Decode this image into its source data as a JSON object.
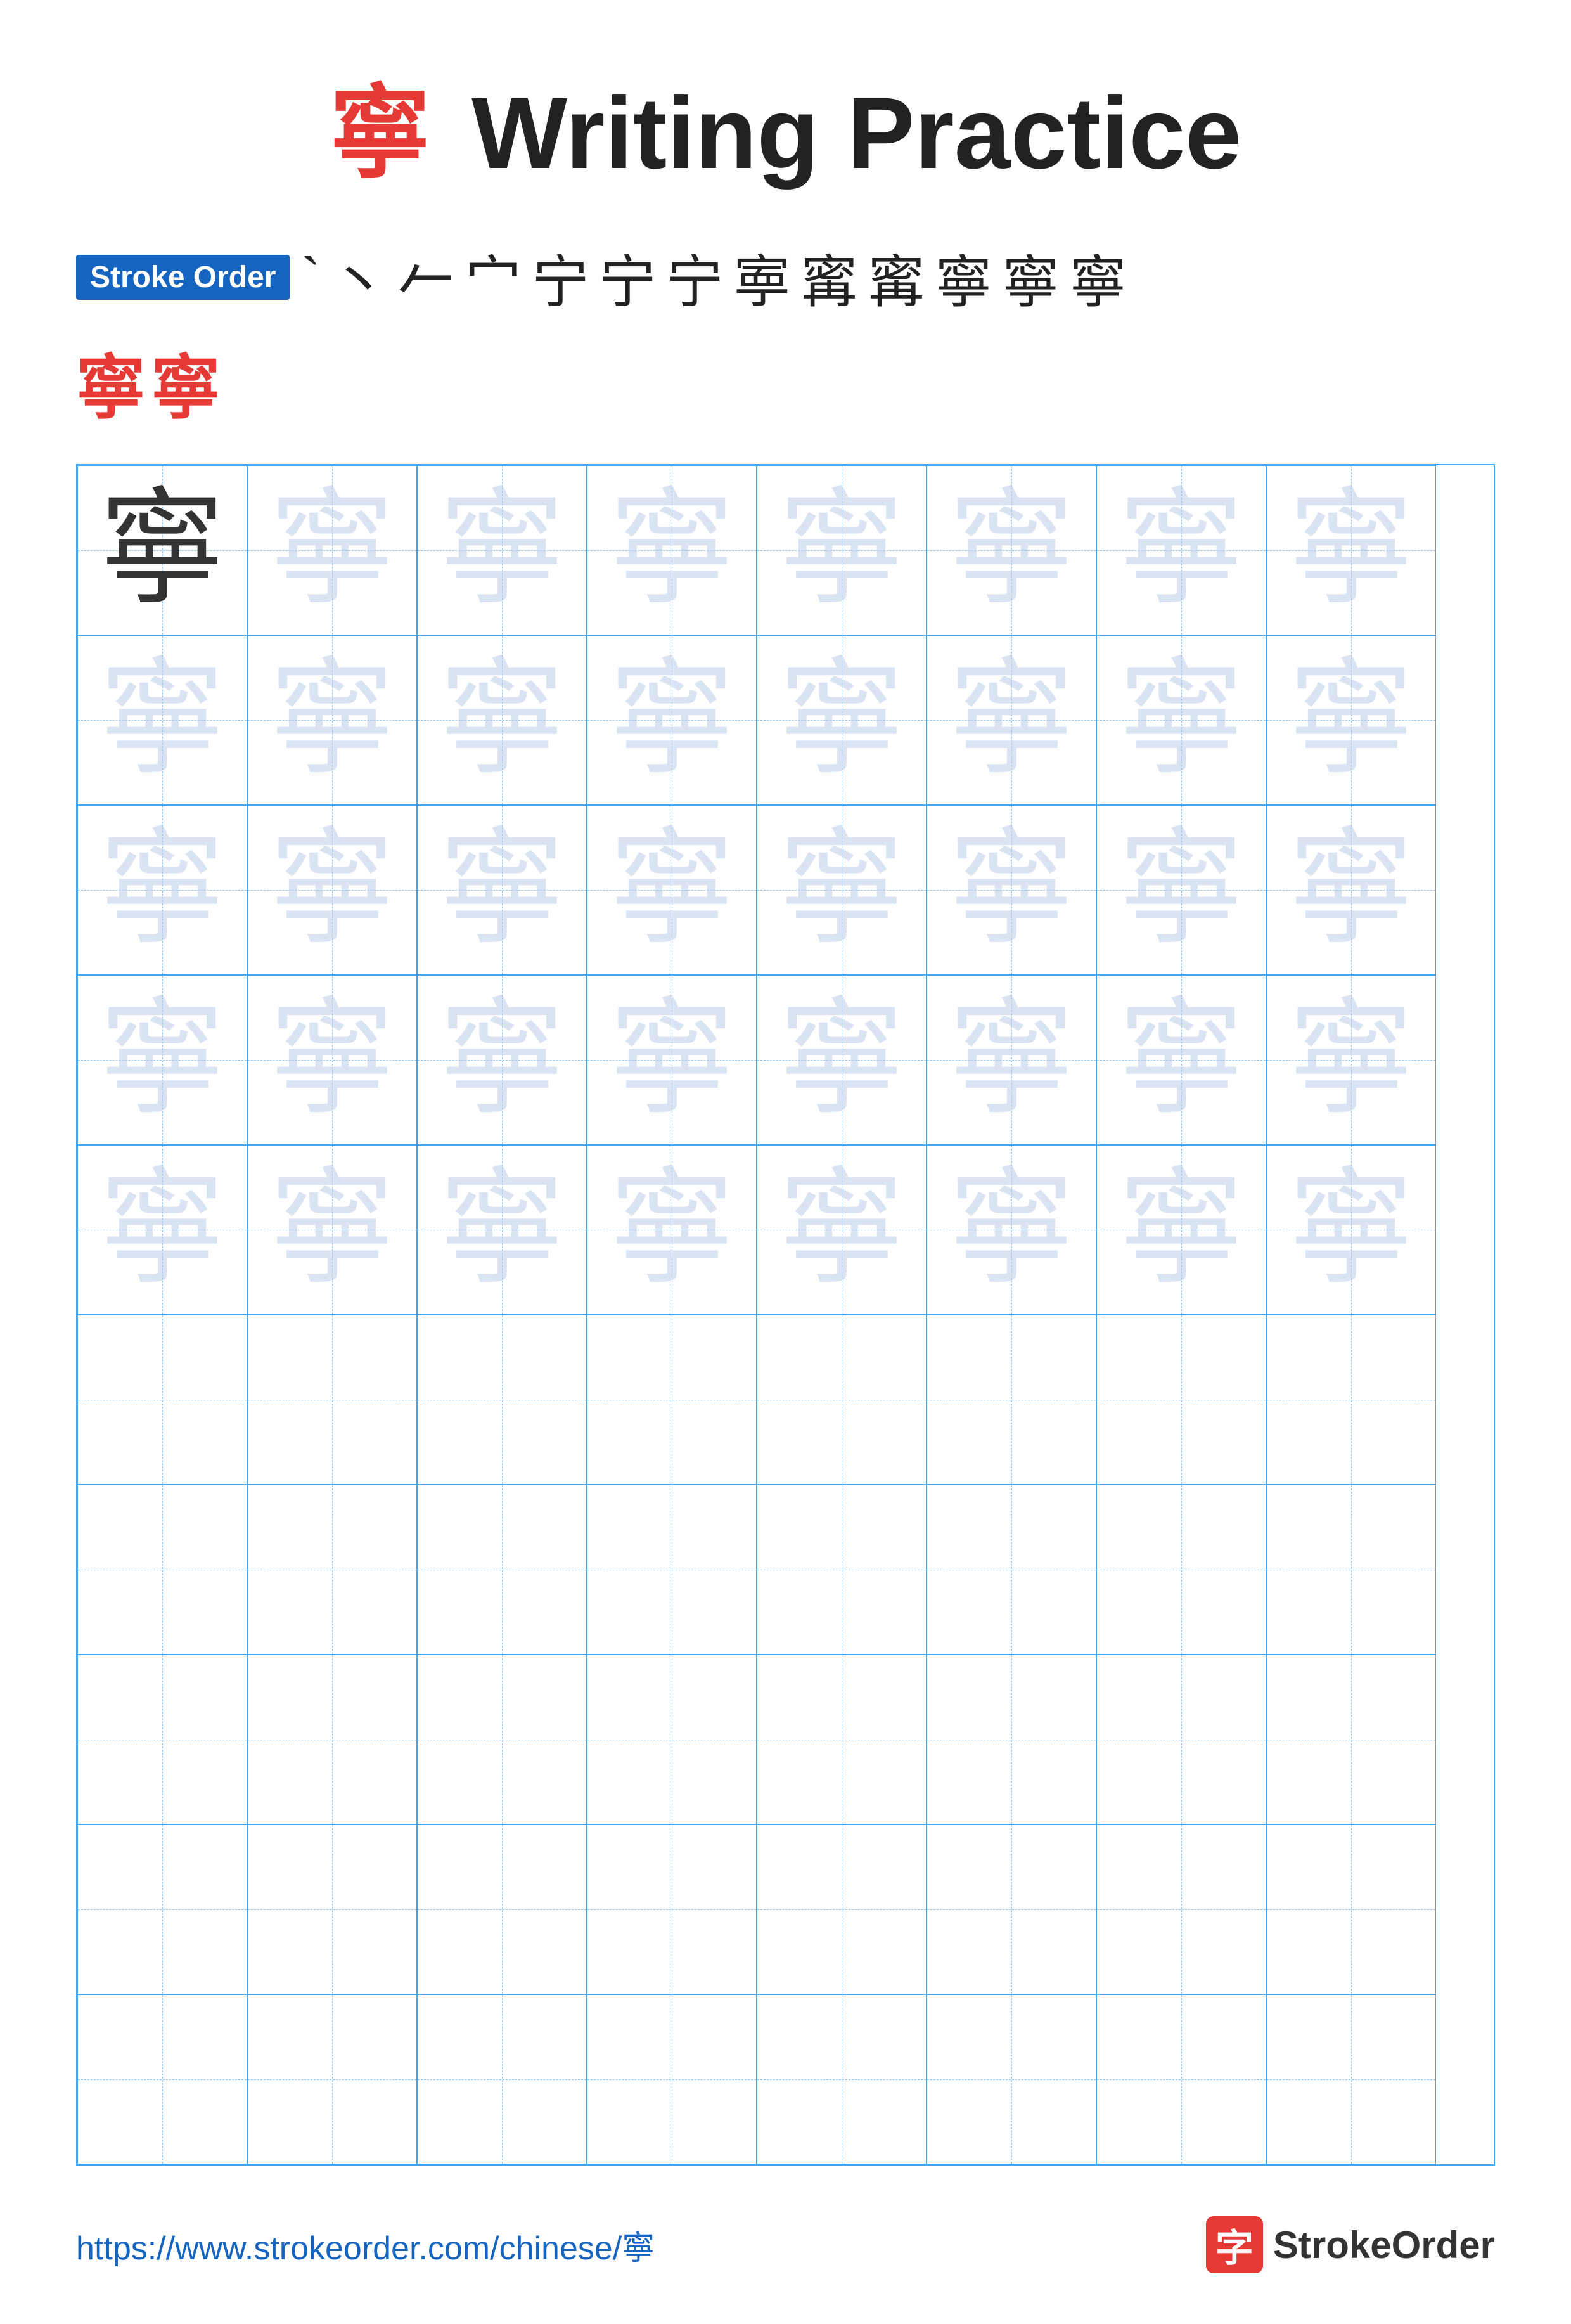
{
  "title": {
    "char": "寧",
    "rest": " Writing Practice"
  },
  "stroke_order": {
    "badge": "Stroke Order",
    "strokes": [
      "`",
      "丶",
      "𠂉",
      "宀",
      "宁",
      "宁",
      "宁",
      "寕",
      "寗",
      "寗",
      "寧",
      "寧",
      "寧"
    ],
    "row2": [
      "寧",
      "寧"
    ]
  },
  "practice_char": "寧",
  "grid": {
    "cols": 8,
    "rows": 10,
    "filled_rows": 5
  },
  "footer": {
    "url": "https://www.strokeorder.com/chinese/寧",
    "brand": "StrokeOrder"
  }
}
